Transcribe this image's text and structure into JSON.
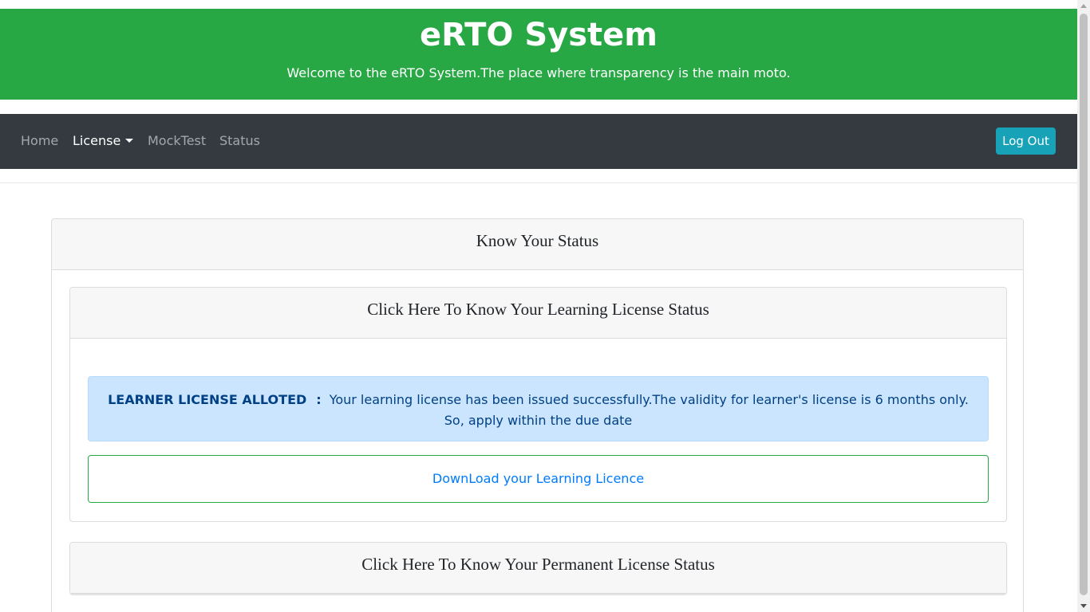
{
  "header": {
    "title": "eRTO System",
    "subtitle": "Welcome to the eRTO System.The place where transparency is the main moto."
  },
  "navbar": {
    "items": [
      {
        "label": "Home"
      },
      {
        "label": "License"
      },
      {
        "label": "MockTest"
      },
      {
        "label": "Status"
      }
    ],
    "logout_label": "Log Out"
  },
  "main": {
    "card_title": "Know Your Status",
    "learning_card": {
      "header": "Click Here To Know Your Learning License Status",
      "alert": {
        "strong": "LEARNER LICENSE ALLOTED",
        "separator": ":",
        "message": "Your learning license has been issued successfully.The validity for learner's license is 6 months only. So, apply within the due date"
      },
      "download_label": "DownLoad your Learning Licence"
    },
    "permanent_card": {
      "header": "Click Here To Know Your Permanent License Status"
    }
  },
  "colors": {
    "header_bg": "#28a745",
    "navbar_bg": "#343a40",
    "logout_bg": "#17a2b8",
    "alert_bg": "#cce5ff",
    "link": "#007bff"
  }
}
